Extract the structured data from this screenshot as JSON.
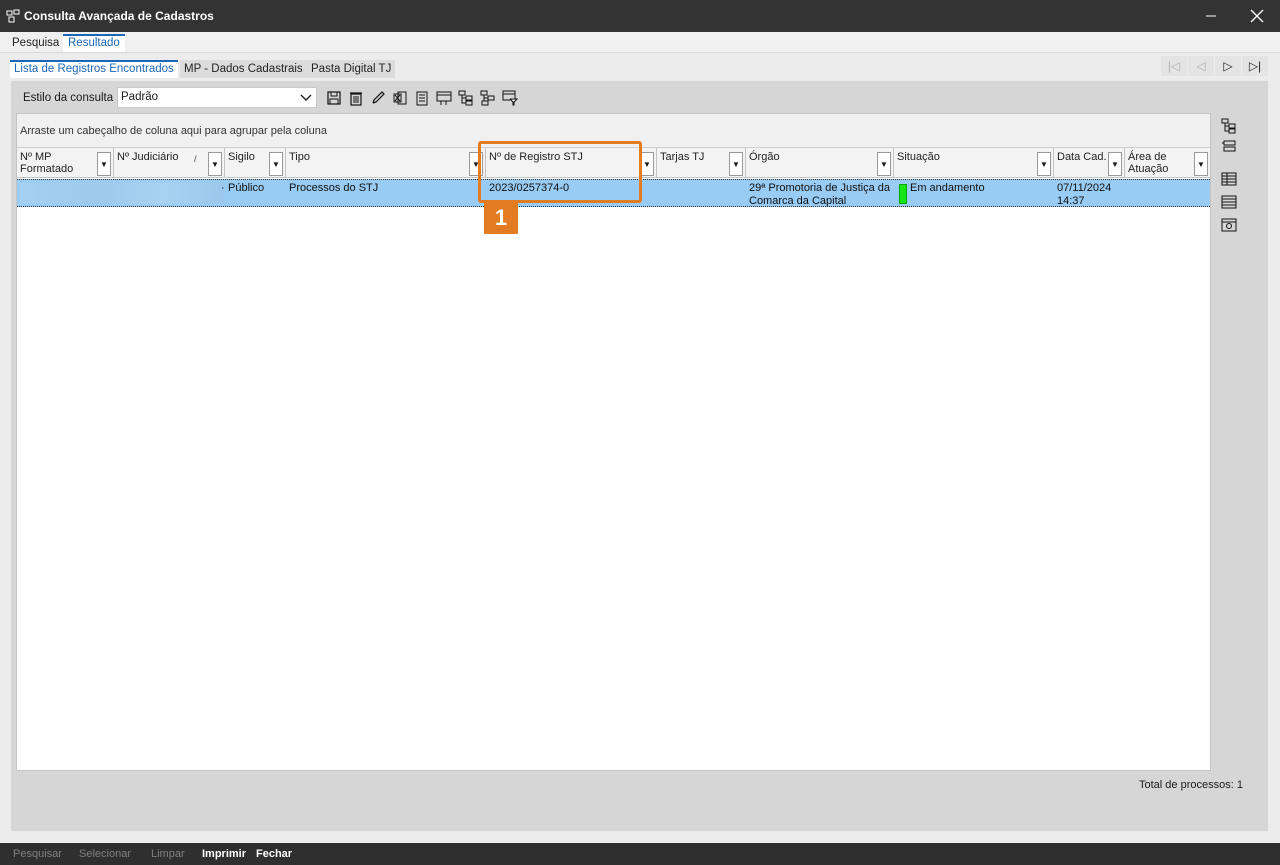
{
  "window": {
    "title": "Consulta Avançada de Cadastros"
  },
  "outer_tabs": [
    "Pesquisa",
    "Resultado"
  ],
  "inner_tabs": [
    "Lista de Registros Encontrados",
    "MP - Dados Cadastrais",
    "Pasta Digital TJ"
  ],
  "toolbar": {
    "style_label": "Estilo da consulta",
    "style_value": "Padrão"
  },
  "grid": {
    "group_hint": "Arraste um cabeçalho de coluna aqui para agrupar pela coluna",
    "columns": {
      "mp_formatado": "Nº MP Formatado",
      "judiciario": "Nº Judiciário",
      "sigilo": "Sigilo",
      "tipo": "Tipo",
      "registro_stj": "Nº de Registro STJ",
      "tarjas_tj": "Tarjas TJ",
      "orgao": "Órgão",
      "situacao": "Situação",
      "data_cad": "Data Cad.",
      "area_atuacao": "Área de Atuação"
    },
    "row": {
      "sigilo": "Público",
      "tipo": "Processos do STJ",
      "registro_stj": "2023/0257374-0",
      "orgao_line1": "29ª Promotoria de Justiça da",
      "orgao_line2": "Comarca da Capital",
      "situacao": "Em andamento",
      "data_line1": "07/11/2024",
      "data_line2": "14:37",
      "status_color": "#19e619"
    }
  },
  "total": "Total de processos: 1",
  "annotation": {
    "badge": "1",
    "color": "#e27b21"
  },
  "bottom": {
    "pesquisar": "Pesquisar",
    "selecionar": "Selecionar",
    "limpar": "Limpar",
    "imprimir": "Imprimir",
    "fechar": "Fechar"
  }
}
